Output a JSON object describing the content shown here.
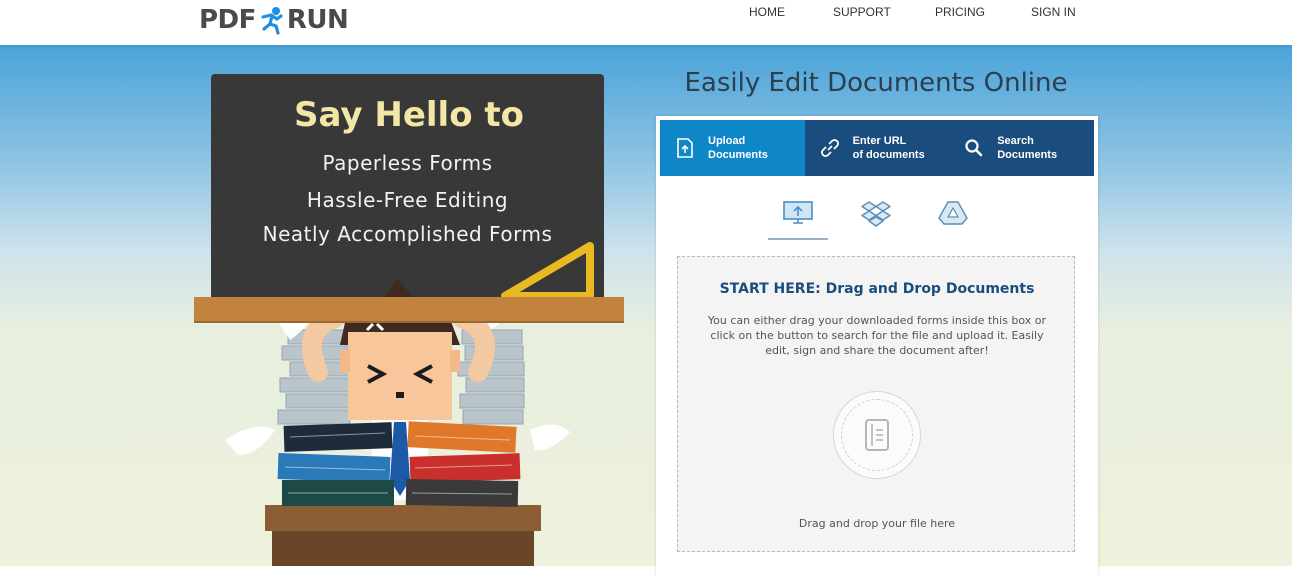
{
  "header": {
    "logo_left": "PDF",
    "logo_right": "RUN",
    "nav": [
      "HOME",
      "SUPPORT",
      "PRICING",
      "SIGN IN"
    ]
  },
  "hero": {
    "board_title": "Say Hello to",
    "board_lines": [
      "Paperless Forms",
      "Hassle-Free Editing",
      "Neatly Accomplished Forms"
    ]
  },
  "panel": {
    "headline": "Easily Edit Documents Online",
    "tabs": [
      {
        "line1": "Upload",
        "line2": "Documents",
        "icon": "upload-icon",
        "active": true
      },
      {
        "line1": "Enter URL",
        "line2": "of documents",
        "icon": "link-icon",
        "active": false
      },
      {
        "line1": "Search",
        "line2": "Documents",
        "icon": "search-icon",
        "active": false
      }
    ],
    "sources": [
      "computer-icon",
      "dropbox-icon",
      "google-drive-icon"
    ],
    "dropzone": {
      "title": "START HERE: Drag and Drop Documents",
      "description": "You can either drag your downloaded forms inside this box or click on the button to search for the file and upload it. Easily edit, sign and share the document after!",
      "hint": "Drag and drop your file here"
    }
  },
  "colors": {
    "tab_active": "#0e86c7",
    "tab_inactive": "#1a4d7d",
    "title_blue": "#1a4d7d",
    "board": "#383838",
    "chalk_title": "#f4e7a6"
  }
}
